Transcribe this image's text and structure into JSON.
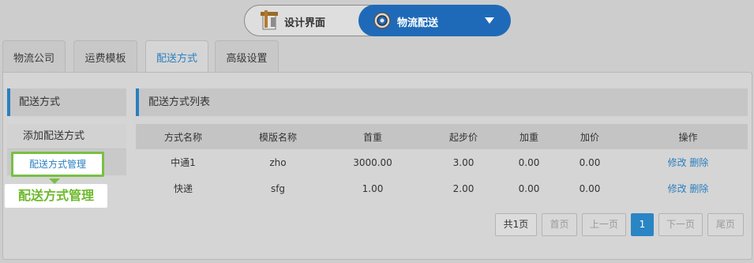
{
  "switcher": {
    "design_label": "设计界面",
    "design_icon": "design-tools-icon",
    "logistics_label": "物流配送",
    "logistics_icon": "gear-icon"
  },
  "tabs": [
    {
      "label": "物流公司",
      "active": false
    },
    {
      "label": "运费模板",
      "active": false
    },
    {
      "label": "配送方式",
      "active": true
    },
    {
      "label": "高级设置",
      "active": false
    }
  ],
  "sidebar": {
    "title": "配送方式",
    "items": [
      {
        "label": "添加配送方式"
      },
      {
        "label": "配送方式管理"
      }
    ]
  },
  "highlight": {
    "box_label": "配送方式管理",
    "tip_label": "配送方式管理"
  },
  "list": {
    "title": "配送方式列表",
    "columns": [
      "方式名称",
      "模版名称",
      "首重",
      "起步价",
      "加重",
      "加价",
      "操作"
    ],
    "rows": [
      {
        "name": "中通1",
        "template": "zho",
        "first_weight": "3000.00",
        "start_price": "3.00",
        "add_weight": "0.00",
        "add_price": "0.00",
        "edit": "修改",
        "delete": "删除"
      },
      {
        "name": "快递",
        "template": "sfg",
        "first_weight": "1.00",
        "start_price": "2.00",
        "add_weight": "0.00",
        "add_price": "0.00",
        "edit": "修改",
        "delete": "删除"
      }
    ]
  },
  "pagination": {
    "total": "共1页",
    "first": "首页",
    "prev": "上一页",
    "current": "1",
    "next": "下一页",
    "last": "尾页"
  },
  "colors": {
    "accent": "#2a7fc0",
    "switch_active": "#1f6ab8",
    "highlight_green": "#77c044"
  }
}
